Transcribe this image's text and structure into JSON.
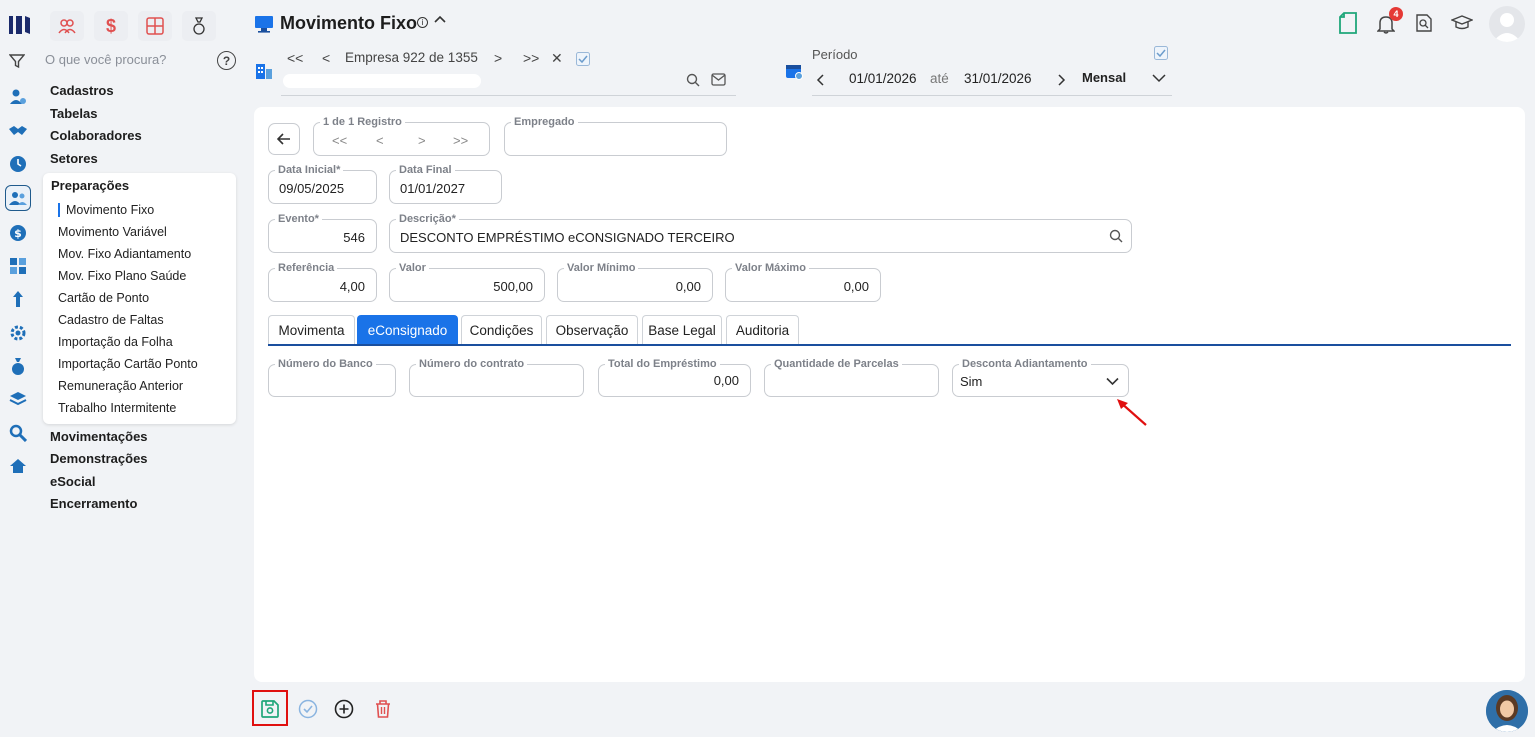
{
  "search": {
    "placeholder": "O que você procura?"
  },
  "help_label": "?",
  "menu": {
    "items_top": [
      "Cadastros",
      "Tabelas",
      "Colaboradores",
      "Setores"
    ],
    "group_title": "Preparações",
    "group_items": [
      "Movimento Fixo",
      "Movimento Variável",
      "Mov. Fixo Adiantamento",
      "Mov. Fixo Plano Saúde",
      "Cartão de Ponto",
      "Cadastro de Faltas",
      "Importação da Folha",
      "Importação Cartão Ponto",
      "Remuneração Anterior",
      "Trabalho Intermitente"
    ],
    "items_bottom": [
      "Movimentações",
      "Demonstrações",
      "eSocial",
      "Encerramento"
    ]
  },
  "header": {
    "title": "Movimento Fixo",
    "info_icon": "i",
    "company_nav": {
      "first": "<<",
      "prev": "<",
      "label": "Empresa 922 de 1355",
      "next": ">",
      "last": ">>",
      "close": "✕"
    },
    "period": {
      "label": "Período",
      "from": "01/01/2026",
      "sep": "até",
      "to": "31/01/2026",
      "mode": "Mensal"
    },
    "notifications_count": "4"
  },
  "form": {
    "record_nav": {
      "label": "1 de 1 Registro",
      "buttons": [
        "<<",
        "<",
        ">",
        ">>"
      ]
    },
    "empregado": {
      "label": "Empregado",
      "value": ""
    },
    "data_inicial": {
      "label": "Data Inicial*",
      "value": "09/05/2025"
    },
    "data_final": {
      "label": "Data Final",
      "value": "01/01/2027"
    },
    "evento": {
      "label": "Evento*",
      "value": "546"
    },
    "descricao": {
      "label": "Descrição*",
      "value": "DESCONTO EMPRÉSTIMO eCONSIGNADO TERCEIRO"
    },
    "referencia": {
      "label": "Referência",
      "value": "4,00"
    },
    "valor": {
      "label": "Valor",
      "value": "500,00"
    },
    "valor_minimo": {
      "label": "Valor Mínimo",
      "value": "0,00"
    },
    "valor_maximo": {
      "label": "Valor Máximo",
      "value": "0,00"
    }
  },
  "tabs": [
    "Movimenta",
    "eConsignado",
    "Condições",
    "Observação",
    "Base Legal",
    "Auditoria"
  ],
  "active_tab": "eConsignado",
  "econsignado": {
    "numero_banco": {
      "label": "Número do Banco",
      "value": ""
    },
    "numero_contrato": {
      "label": "Número do contrato",
      "value": ""
    },
    "total_emprestimo": {
      "label": "Total do Empréstimo",
      "value": "0,00"
    },
    "qtd_parcelas": {
      "label": "Quantidade de Parcelas",
      "value": ""
    },
    "desconta_adiantamento": {
      "label": "Desconta Adiantamento",
      "value": "Sim"
    }
  },
  "colors": {
    "accent": "#1a73e8",
    "save_green": "#1fa67a",
    "delete_red": "#e05050",
    "highlight_red": "#e01010"
  }
}
